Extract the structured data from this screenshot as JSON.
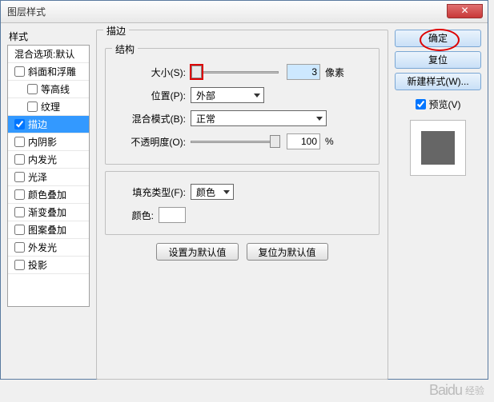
{
  "title": "图层样式",
  "close_label": "✕",
  "left": {
    "panel_label": "样式",
    "blend_options": "混合选项:默认",
    "items": [
      {
        "label": "斜面和浮雕",
        "checked": false
      },
      {
        "label": "等高线",
        "checked": false,
        "indent": true
      },
      {
        "label": "纹理",
        "checked": false,
        "indent": true
      },
      {
        "label": "描边",
        "checked": true,
        "selected": true
      },
      {
        "label": "内阴影",
        "checked": false
      },
      {
        "label": "内发光",
        "checked": false
      },
      {
        "label": "光泽",
        "checked": false
      },
      {
        "label": "颜色叠加",
        "checked": false
      },
      {
        "label": "渐变叠加",
        "checked": false
      },
      {
        "label": "图案叠加",
        "checked": false
      },
      {
        "label": "外发光",
        "checked": false
      },
      {
        "label": "投影",
        "checked": false
      }
    ]
  },
  "main": {
    "outer_group": "描边",
    "inner_group": "结构",
    "size_label": "大小(S):",
    "size_value": "3",
    "size_unit": "像素",
    "position_label": "位置(P):",
    "position_value": "外部",
    "blend_label": "混合模式(B):",
    "blend_value": "正常",
    "opacity_label": "不透明度(O):",
    "opacity_value": "100",
    "opacity_unit": "%",
    "filltype_label": "填充类型(F):",
    "filltype_value": "颜色",
    "color_label": "颜色:",
    "reset_btn": "设置为默认值",
    "restore_btn": "复位为默认值"
  },
  "right": {
    "ok": "确定",
    "reset": "复位",
    "new_style": "新建样式(W)...",
    "preview_label": "预览(V)"
  },
  "footer": {
    "brand": "Baidu",
    "sub": "经验"
  }
}
